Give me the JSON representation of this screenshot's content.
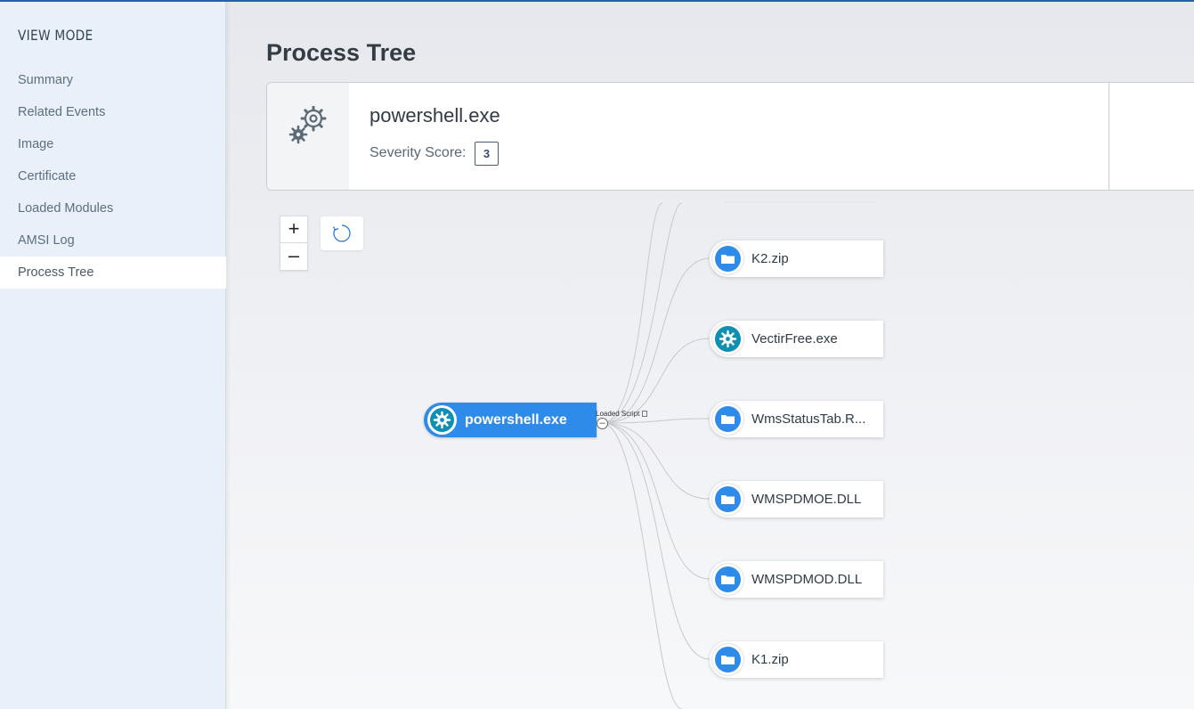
{
  "sidebar": {
    "title": "VIEW MODE",
    "items": [
      {
        "label": "Summary"
      },
      {
        "label": "Related Events"
      },
      {
        "label": "Image"
      },
      {
        "label": "Certificate"
      },
      {
        "label": "Loaded Modules"
      },
      {
        "label": "AMSI Log"
      },
      {
        "label": "Process Tree",
        "active": true
      }
    ]
  },
  "main": {
    "title": "Process Tree",
    "process": {
      "name": "powershell.exe",
      "severity_label": "Severity Score:",
      "severity_value": "3",
      "icon": "gears-icon"
    },
    "controls": {
      "zoom_in": "+",
      "zoom_out": "–",
      "refresh_icon": "refresh-icon"
    },
    "tree": {
      "root": {
        "label": "powershell.exe",
        "icon": "gear-icon"
      },
      "edge_label": "Loaded Script",
      "collapse_symbol": "–",
      "children": [
        {
          "label": "K2.zip",
          "icon": "folder-icon"
        },
        {
          "label": "VectirFree.exe",
          "icon": "gear-icon"
        },
        {
          "label": "WmsStatusTab.R...",
          "icon": "folder-icon"
        },
        {
          "label": "WMSPDMOE.DLL",
          "icon": "folder-icon"
        },
        {
          "label": "WMSPDMOD.DLL",
          "icon": "folder-icon"
        },
        {
          "label": "K1.zip",
          "icon": "folder-icon"
        }
      ]
    }
  },
  "colors": {
    "accent": "#2e8bea",
    "process_teal": "#0f8fb1",
    "sidebar_bg": "#eaf0f9"
  }
}
